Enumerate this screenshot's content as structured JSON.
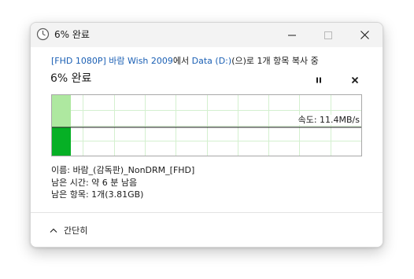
{
  "window": {
    "title": "6% 완료"
  },
  "copy": {
    "source": "[FHD 1080P] 바람 Wish 2009",
    "from_text": "에서 ",
    "destination": "Data (D:)",
    "suffix": "(으)로 1개 항목 복사 중",
    "percent_title": "6% 완료",
    "progress_fraction": 0.06,
    "speed_label": "속도: 11.4MB/s"
  },
  "details": {
    "name_label": "이름: 바람_(감독판)_NonDRM_[FHD]",
    "time_label": "남은 시간: 약 6 분 남음",
    "items_label": "남은 항목: 1개(3.81GB)"
  },
  "footer": {
    "collapse_label": "간단히"
  },
  "colors": {
    "accent_fill": "#aee8a0",
    "speed_fill": "#06b025",
    "grid": "#d4f0cf",
    "link": "#1a5fb4"
  },
  "icons": {
    "app": "clock-icon",
    "pause": "pause-icon",
    "cancel": "close-icon",
    "collapse": "chevron-up-icon"
  }
}
